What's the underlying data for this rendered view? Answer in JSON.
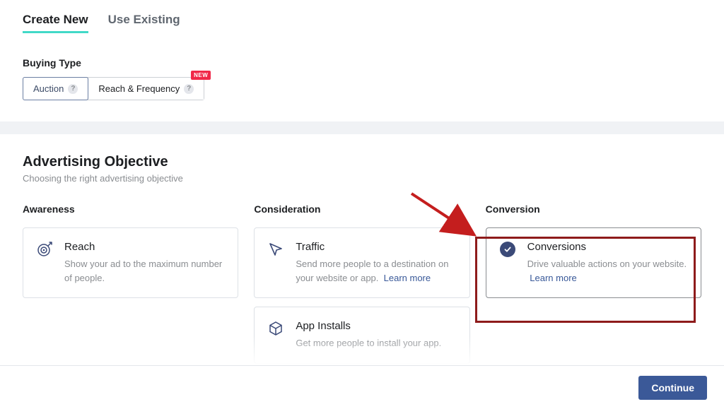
{
  "tabs": {
    "create_new": "Create New",
    "use_existing": "Use Existing"
  },
  "buying": {
    "label": "Buying Type",
    "auction": "Auction",
    "reach_frequency": "Reach & Frequency",
    "new_badge": "NEW"
  },
  "objective": {
    "title": "Advertising Objective",
    "subtitle": "Choosing the right advertising objective"
  },
  "columns": {
    "awareness": {
      "title": "Awareness",
      "cards": [
        {
          "title": "Reach",
          "desc": "Show your ad to the maximum number of people."
        }
      ]
    },
    "consideration": {
      "title": "Consideration",
      "cards": [
        {
          "title": "Traffic",
          "desc": "Send more people to a destination on your website or app.",
          "learn_more": "Learn more"
        },
        {
          "title": "App Installs",
          "desc": "Get more people to install your app."
        }
      ]
    },
    "conversion": {
      "title": "Conversion",
      "cards": [
        {
          "title": "Conversions",
          "desc": "Drive valuable actions on your website.",
          "learn_more": "Learn more"
        }
      ]
    }
  },
  "footer": {
    "continue": "Continue"
  },
  "colors": {
    "accent_teal": "#42d9c8",
    "link": "#385898",
    "badge_red": "#f02849",
    "primary_button": "#3b5998",
    "annotation_red": "#8e1b1b"
  }
}
